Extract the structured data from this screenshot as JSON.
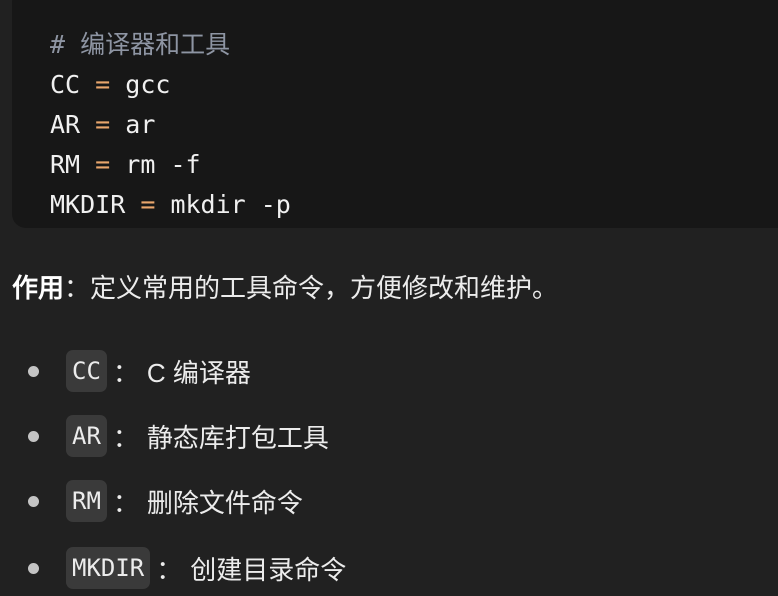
{
  "code_block": {
    "lines": [
      {
        "type": "comment",
        "text": "# 编译器和工具"
      },
      {
        "type": "assign",
        "name": "CC",
        "op": "=",
        "value": "gcc"
      },
      {
        "type": "assign",
        "name": "AR",
        "op": "=",
        "value": "ar"
      },
      {
        "type": "assign",
        "name": "RM",
        "op": "=",
        "value": "rm -f"
      },
      {
        "type": "assign",
        "name": "MKDIR",
        "op": "=",
        "value": "mkdir -p"
      }
    ]
  },
  "description": {
    "label": "作用",
    "separator": "：",
    "text": "定义常用的工具命令，方便修改和维护。"
  },
  "list": [
    {
      "code": "CC",
      "sep": "：",
      "text": "C 编译器"
    },
    {
      "code": "AR",
      "sep": "：",
      "text": "静态库打包工具"
    },
    {
      "code": "RM",
      "sep": "：",
      "text": "删除文件命令"
    },
    {
      "code": "MKDIR",
      "sep": "：",
      "text": "创建目录命令"
    }
  ]
}
